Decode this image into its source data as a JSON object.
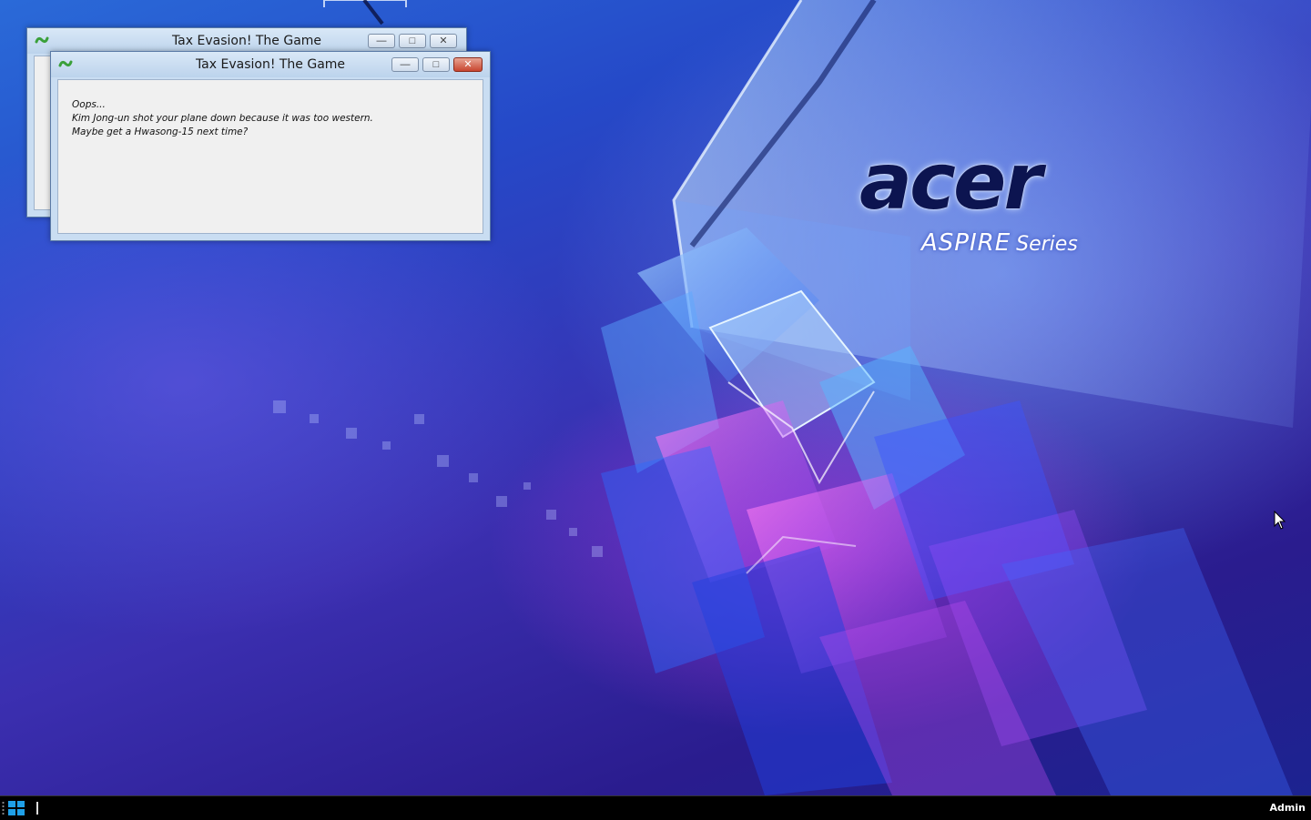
{
  "desktop": {
    "brand": "acer",
    "model_line": "ASPIRE",
    "model_suffix": "Series"
  },
  "windows": [
    {
      "title": "Tax Evasion! The Game",
      "state": "background"
    },
    {
      "title": "Tax Evasion! The Game",
      "state": "active",
      "message_lines": [
        "Oops...",
        "Kim Jong-un shot your plane down because it was too western.",
        "Maybe get a Hwasong-15 next time?"
      ]
    }
  ],
  "taskbar": {
    "user": "Admin"
  },
  "icons": {
    "app": "snake-game-icon",
    "minimize": "minimize-icon",
    "maximize": "maximize-icon",
    "close": "close-icon",
    "start": "windows-logo-icon",
    "cursor": "mouse-pointer-icon"
  },
  "colors": {
    "close_button": "#c8452f",
    "taskbar": "#000000",
    "wallpaper_base": "#2549c8"
  }
}
